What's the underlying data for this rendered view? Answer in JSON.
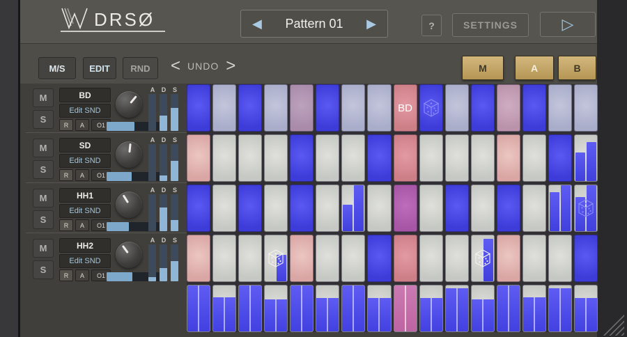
{
  "header": {
    "logo_text": "DRSØ",
    "pattern": {
      "prev": "◀",
      "label": "Pattern 01",
      "next": "▶"
    },
    "help_label": "?",
    "settings_label": "SETTINGS",
    "play_icon": "▷"
  },
  "toolbar": {
    "ms_label": "M/S",
    "edit_label": "EDIT",
    "rnd_label": "RND",
    "undo": {
      "prev": "<",
      "label": "UNDO",
      "next": ">"
    },
    "banks": {
      "m": "M",
      "a": "A",
      "b": "B"
    }
  },
  "colors": {
    "accent_gold": "#c9ac72",
    "step_on": [
      "#5b59f2",
      "#3e3cd9"
    ],
    "step_off_grey": [
      "#dfe0dc",
      "#c6c8c4"
    ],
    "step_off_lavender": [
      "#c3c5db",
      "#aaadca"
    ],
    "step_off_pink": [
      "#ecc6c2",
      "#d9a6a4"
    ],
    "playhead_pink": [
      "#e39aa2",
      "#cd7f88"
    ],
    "playhead_purple": [
      "#bc6cbb",
      "#a656a5"
    ],
    "velocity_blue": [
      "#5e5cf2",
      "#4240e0"
    ],
    "velocity_playhead": [
      "#cb7ab2",
      "#bd64a2"
    ],
    "meter_fill": "#8fb6d6"
  },
  "tracks": [
    {
      "name": "BD",
      "edit_label": "Edit SND",
      "r": "R",
      "a": "A",
      "o1": "O1",
      "mute": "M",
      "solo": "S",
      "knob_angle": 40,
      "slider_pct": 50,
      "env_labels": [
        "A",
        "D",
        "S"
      ],
      "env_values": [
        0,
        42,
        62
      ],
      "off_style": "lavender",
      "steps": [
        {
          "s": "on"
        },
        {
          "s": "off"
        },
        {
          "s": "on"
        },
        {
          "s": "off"
        },
        {
          "s": "off",
          "bg": [
            "#bca2bd",
            "#a98ba9"
          ]
        },
        {
          "s": "on"
        },
        {
          "s": "off"
        },
        {
          "s": "off"
        },
        {
          "s": "ph",
          "label": "BD"
        },
        {
          "s": "on",
          "dice": "blue"
        },
        {
          "s": "off"
        },
        {
          "s": "on"
        },
        {
          "s": "off",
          "bg": [
            "#cfadc1",
            "#ba93ab"
          ]
        },
        {
          "s": "on"
        },
        {
          "s": "off"
        },
        {
          "s": "off"
        }
      ]
    },
    {
      "name": "SD",
      "edit_label": "Edit SND",
      "r": "R",
      "a": "A",
      "o1": "O1",
      "mute": "M",
      "solo": "S",
      "knob_angle": 6,
      "slider_pct": 45,
      "env_labels": [
        "A",
        "D",
        "S"
      ],
      "env_values": [
        0,
        15,
        55
      ],
      "off_style": "grey",
      "steps": [
        {
          "s": "off",
          "bg": [
            "#ecc6c2",
            "#d9a6a4"
          ]
        },
        {
          "s": "off"
        },
        {
          "s": "off"
        },
        {
          "s": "off"
        },
        {
          "s": "on"
        },
        {
          "s": "off"
        },
        {
          "s": "off"
        },
        {
          "s": "on"
        },
        {
          "s": "ph"
        },
        {
          "s": "off"
        },
        {
          "s": "off"
        },
        {
          "s": "off"
        },
        {
          "s": "off",
          "bg": [
            "#ecc6c2",
            "#d9a6a4"
          ]
        },
        {
          "s": "off"
        },
        {
          "s": "on"
        },
        {
          "s": "off",
          "bars": [
            62,
            85
          ]
        }
      ]
    },
    {
      "name": "HH1",
      "edit_label": "Edit SND",
      "r": "R",
      "a": "A",
      "o1": "O1",
      "mute": "M",
      "solo": "S",
      "knob_angle": -32,
      "slider_pct": 40,
      "env_labels": [
        "A",
        "D",
        "S"
      ],
      "env_values": [
        0,
        65,
        30
      ],
      "off_style": "grey",
      "steps": [
        {
          "s": "on"
        },
        {
          "s": "off"
        },
        {
          "s": "on"
        },
        {
          "s": "off"
        },
        {
          "s": "on"
        },
        {
          "s": "off"
        },
        {
          "s": "off",
          "bars": [
            58,
            100
          ]
        },
        {
          "s": "off"
        },
        {
          "s": "ph_on"
        },
        {
          "s": "off"
        },
        {
          "s": "on"
        },
        {
          "s": "off"
        },
        {
          "s": "on"
        },
        {
          "s": "off"
        },
        {
          "s": "off",
          "bars": [
            85,
            100
          ]
        },
        {
          "s": "off",
          "bars": [
            75,
            100
          ],
          "dice": "blue"
        }
      ]
    },
    {
      "name": "HH2",
      "edit_label": "Edit SND",
      "r": "R",
      "a": "A",
      "o1": "O1",
      "mute": "M",
      "solo": "S",
      "knob_angle": -36,
      "slider_pct": 46,
      "env_labels": [
        "A",
        "D",
        "S"
      ],
      "env_values": [
        12,
        35,
        55
      ],
      "off_style": "grey",
      "steps": [
        {
          "s": "off",
          "bg": [
            "#ecc6c2",
            "#d9a6a4"
          ]
        },
        {
          "s": "off"
        },
        {
          "s": "off"
        },
        {
          "s": "off",
          "bars": [
            0,
            58
          ],
          "dice": "white"
        },
        {
          "s": "off",
          "bg": [
            "#ecc6c2",
            "#d9a6a4"
          ]
        },
        {
          "s": "off"
        },
        {
          "s": "off"
        },
        {
          "s": "on"
        },
        {
          "s": "ph"
        },
        {
          "s": "off"
        },
        {
          "s": "off"
        },
        {
          "s": "off",
          "bars": [
            0,
            93
          ],
          "dice": "white"
        },
        {
          "s": "off",
          "bg": [
            "#ecc6c2",
            "#d9a6a4"
          ]
        },
        {
          "s": "off"
        },
        {
          "s": "off"
        },
        {
          "s": "on"
        }
      ]
    }
  ],
  "velocity_row": {
    "values": [
      100,
      74,
      100,
      70,
      100,
      73,
      100,
      72,
      100,
      72,
      94,
      70,
      100,
      75,
      94,
      72
    ],
    "playhead_index": 8
  }
}
